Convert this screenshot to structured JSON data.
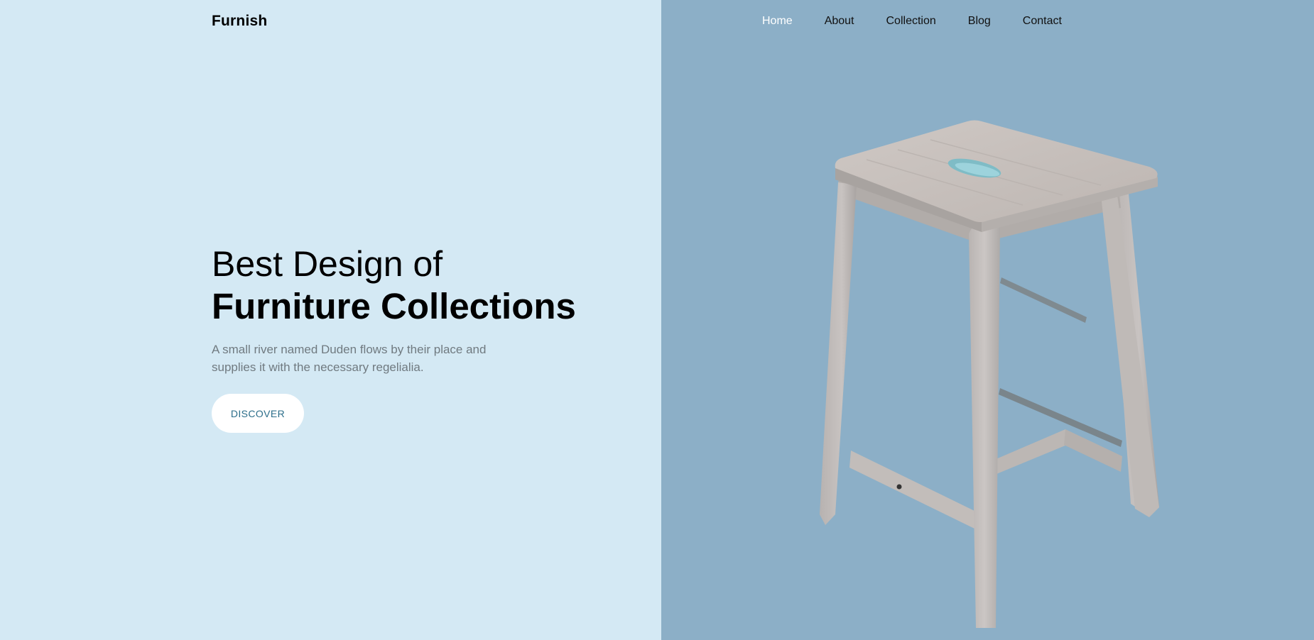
{
  "brand": {
    "name": "Furnish"
  },
  "nav": {
    "items": [
      {
        "label": "Home",
        "active": true
      },
      {
        "label": "About",
        "active": false
      },
      {
        "label": "Collection",
        "active": false
      },
      {
        "label": "Blog",
        "active": false
      },
      {
        "label": "Contact",
        "active": false
      }
    ]
  },
  "hero": {
    "title_line1": "Best Design of",
    "title_line2": "Furniture Collections",
    "description": "A small river named Duden flows by their place and supplies it with the necessary regelialia.",
    "cta_label": "DISCOVER"
  },
  "colors": {
    "left_bg": "#d4e9f4",
    "right_bg": "#8cafc7",
    "cta_text": "#2c6e8a",
    "nav_active": "#ffffff"
  },
  "image": {
    "icon": "stool-illustration"
  }
}
